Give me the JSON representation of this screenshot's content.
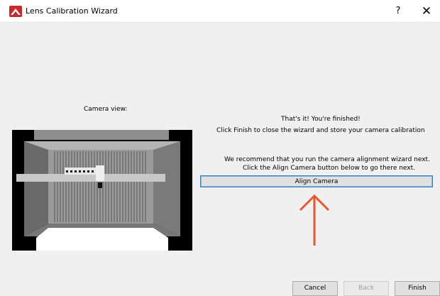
{
  "window": {
    "title": "Lens Calibration Wizard",
    "help_label": "?",
    "close_label": "✕",
    "icon": "lens-app-icon"
  },
  "camera": {
    "label": "Camera view:"
  },
  "messages": {
    "finished": "That's it!  You're finished!",
    "finish_instruction": "Click Finish to close the wizard and store your camera calibration",
    "recommend": "We recommend that you run the camera alignment wizard next.",
    "align_instruction": "Click the Align Camera button below to go there next."
  },
  "buttons": {
    "align_camera": "Align Camera",
    "cancel": "Cancel",
    "back": "Back",
    "finish": "Finish"
  },
  "colors": {
    "accent_border": "#3c7fb1",
    "arrow": "#e8572a",
    "app_icon": "#c62a2a"
  }
}
